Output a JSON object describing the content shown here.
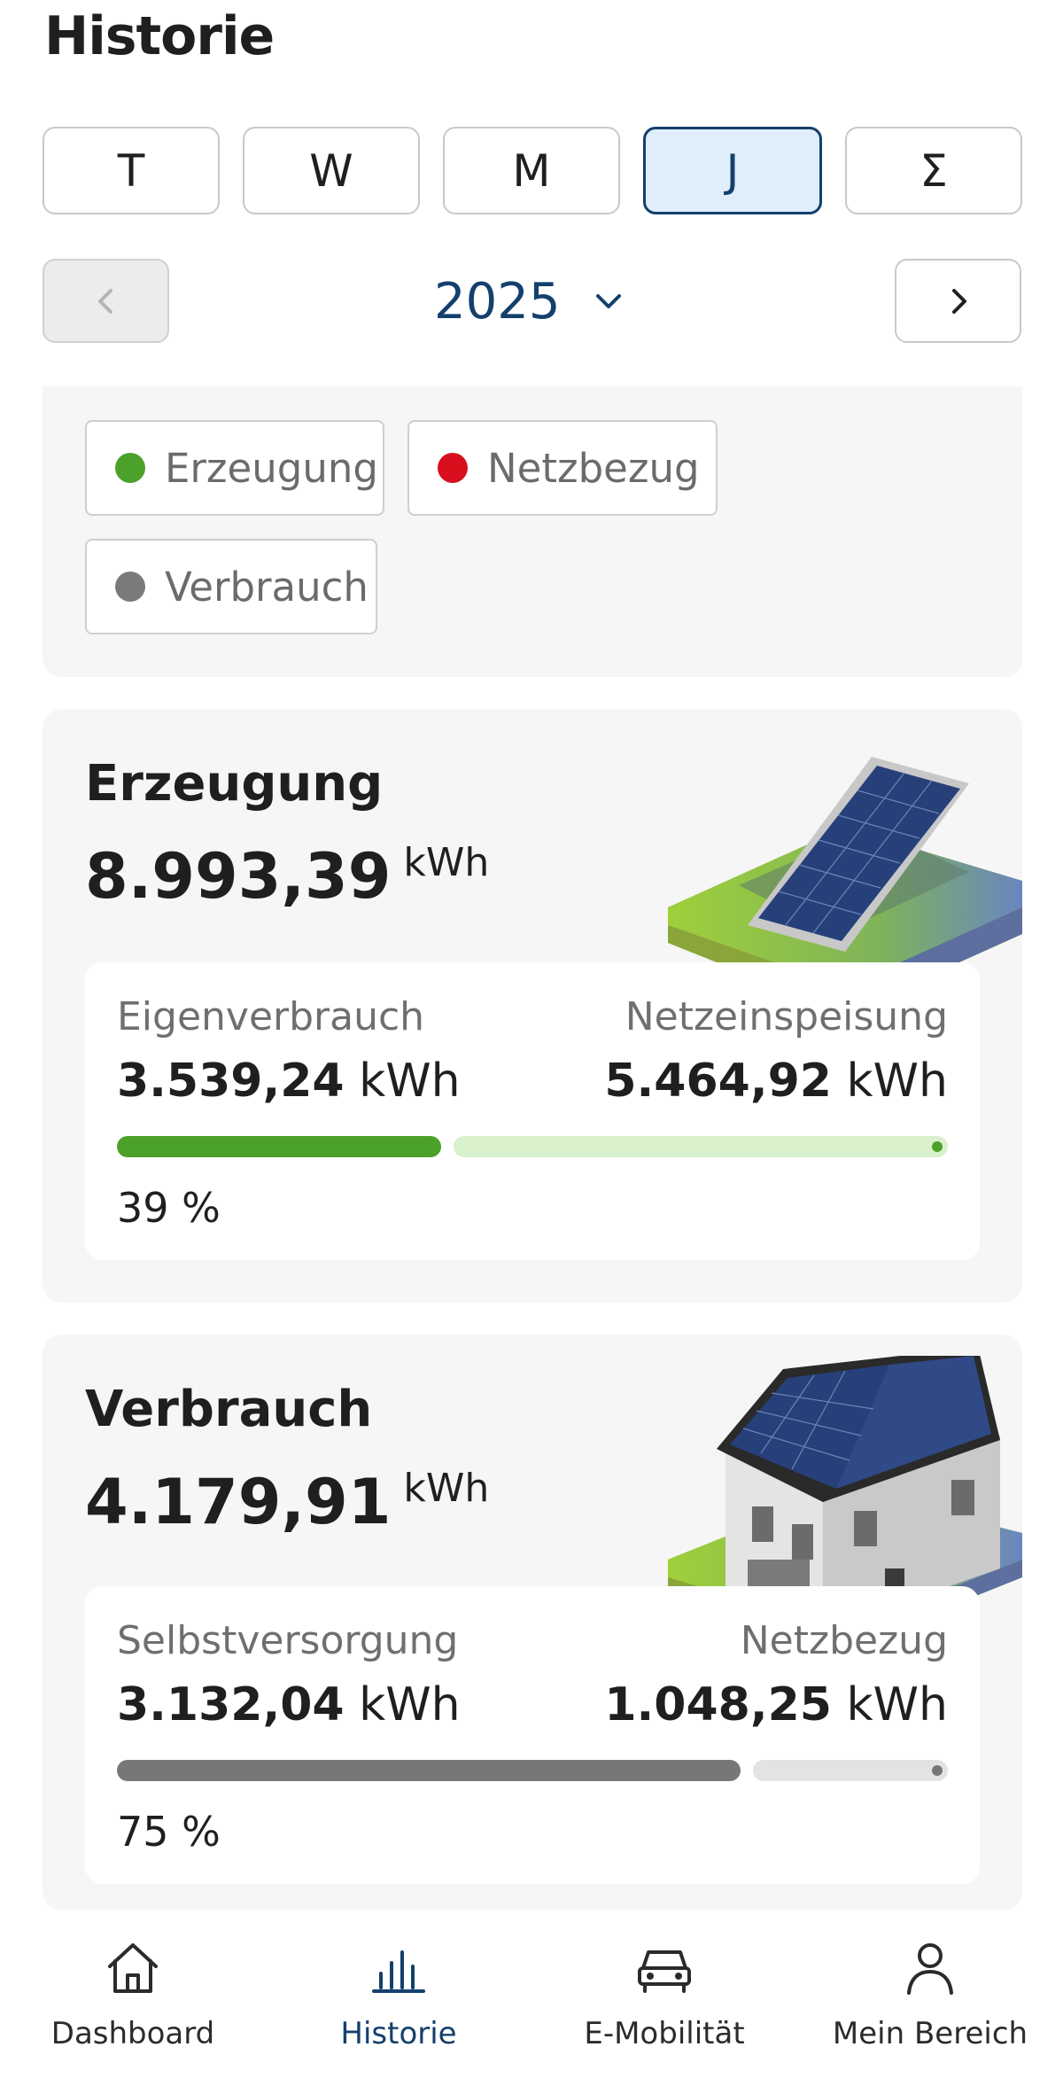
{
  "header": {
    "title": "Historie"
  },
  "period_tabs": [
    {
      "label": "T",
      "active": false
    },
    {
      "label": "W",
      "active": false
    },
    {
      "label": "M",
      "active": false
    },
    {
      "label": "J",
      "active": true
    },
    {
      "label": "Σ",
      "active": false
    }
  ],
  "year_nav": {
    "year": "2025",
    "prev_icon": "chevron-left-icon",
    "next_icon": "chevron-right-icon",
    "dropdown_icon": "chevron-down-icon",
    "prev_enabled": false
  },
  "legend": [
    {
      "label": "Erzeugung",
      "color": "#4ca12a"
    },
    {
      "label": "Netzbezug",
      "color": "#d90f1e"
    },
    {
      "label": "Verbrauch",
      "color": "#7a7a7a"
    }
  ],
  "generation": {
    "title": "Erzeugung",
    "total": "8.993,39",
    "total_unit": "kWh",
    "left_label": "Eigenverbrauch",
    "left_value": "3.539,24",
    "left_unit": "kWh",
    "right_label": "Netzeinspeisung",
    "right_value": "5.464,92",
    "right_unit": "kWh",
    "percent_text": "39 %",
    "share_fraction": 0.39,
    "bar_color": "#4ca12a",
    "rest_color": "#d9f0cc",
    "illustration": "solar-panel-illustration"
  },
  "consumption": {
    "title": "Verbrauch",
    "total": "4.179,91",
    "total_unit": "kWh",
    "left_label": "Selbstversorgung",
    "left_value": "3.132,04",
    "left_unit": "kWh",
    "right_label": "Netzbezug",
    "right_value": "1.048,25",
    "right_unit": "kWh",
    "percent_text": "75 %",
    "share_fraction": 0.75,
    "bar_color": "#777777",
    "rest_color": "#e3e3e3",
    "illustration": "house-illustration"
  },
  "bottom_nav": [
    {
      "label": "Dashboard",
      "icon": "home-icon",
      "active": false
    },
    {
      "label": "Historie",
      "icon": "chart-icon",
      "active": true
    },
    {
      "label": "E-Mobilität",
      "icon": "car-icon",
      "active": false
    },
    {
      "label": "Mein Bereich",
      "icon": "user-icon",
      "active": false
    }
  ],
  "accent_color": "#14406d"
}
